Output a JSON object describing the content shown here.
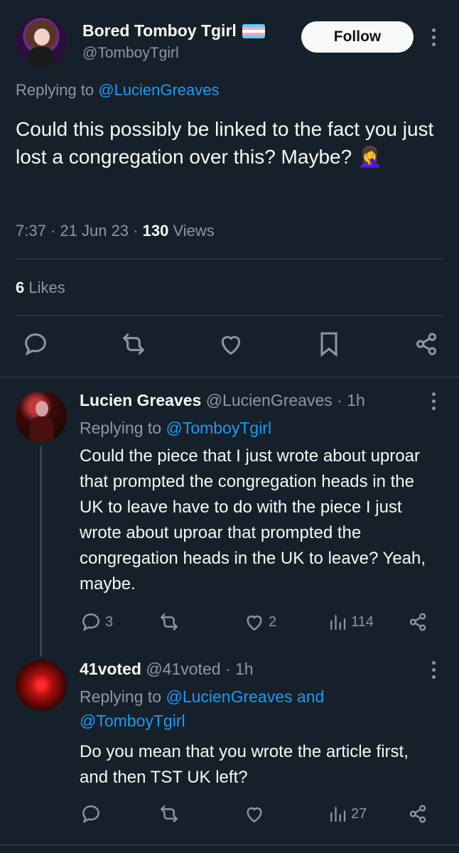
{
  "main_tweet": {
    "display_name": "Bored Tomboy Tgirl",
    "handle": "@TomboyTgirl",
    "follow_label": "Follow",
    "replying_prefix": "Replying to",
    "replying_to": "@LucienGreaves",
    "text": "Could this possibly be linked to the fact you just lost a congregation over this? Maybe? 🤦‍♀️",
    "time": "7:37",
    "date": "21 Jun 23",
    "views_count": "130",
    "views_label": "Views",
    "likes_count": "6",
    "likes_label": "Likes",
    "flag_colors": [
      "#5bcefa",
      "#f5a9b8",
      "#ffffff",
      "#f5a9b8",
      "#5bcefa"
    ],
    "actions": [
      "reply-icon",
      "retweet-icon",
      "like-icon",
      "bookmark-icon",
      "share-icon"
    ]
  },
  "replies": [
    {
      "display_name": "Lucien Greaves",
      "handle": "@LucienGreaves",
      "age": "1h",
      "replying_prefix": "Replying to",
      "replying_to": "@TomboyTgirl",
      "text": "Could the piece that I just wrote about uproar that prompted the congregation heads in the UK to leave have to do with the piece I just wrote about uproar that prompted the congregation heads in the UK to leave? Yeah, maybe.",
      "reply_count": "3",
      "retweet_count": "",
      "like_count": "2",
      "view_count": "114"
    },
    {
      "display_name": "41voted",
      "handle": "@41voted",
      "age": "1h",
      "replying_prefix": "Replying to",
      "replying_to": "@LucienGreaves and @TomboyTgirl",
      "replying_line1": "@LucienGreaves and",
      "replying_line2": "@TomboyTgirl",
      "text": "Do you mean that you wrote the article first, and then TST UK left?",
      "reply_count": "",
      "retweet_count": "",
      "like_count": "",
      "view_count": "27"
    }
  ],
  "colors": {
    "background": "#15202b",
    "text": "#f7f9f9",
    "muted": "#8b98a5",
    "link": "#1d9bf0",
    "divider": "#38444d"
  }
}
